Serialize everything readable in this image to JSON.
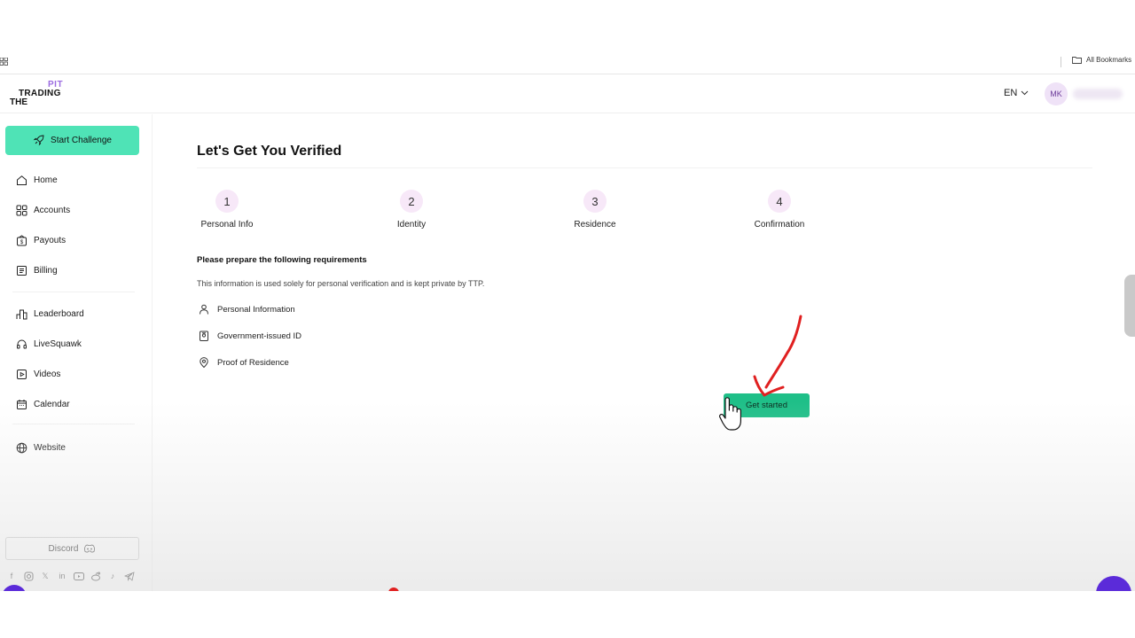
{
  "browser": {
    "bookmarks_label": "All Bookmarks"
  },
  "header": {
    "logo": {
      "the": "THE",
      "trading": "TRADING",
      "pit": "PIT"
    },
    "language": "EN",
    "avatar_initials": "MK"
  },
  "sidebar": {
    "start_challenge": "Start Challenge",
    "items": [
      {
        "label": "Home",
        "icon": "home-icon"
      },
      {
        "label": "Accounts",
        "icon": "grid-icon"
      },
      {
        "label": "Payouts",
        "icon": "wallet-icon"
      },
      {
        "label": "Billing",
        "icon": "document-icon"
      },
      {
        "label": "Leaderboard",
        "icon": "podium-icon"
      },
      {
        "label": "LiveSquawk",
        "icon": "headset-icon"
      },
      {
        "label": "Videos",
        "icon": "video-icon"
      },
      {
        "label": "Calendar",
        "icon": "calendar-icon"
      },
      {
        "label": "Website",
        "icon": "globe-icon"
      }
    ],
    "discord_label": "Discord",
    "socials": [
      "facebook-icon",
      "instagram-icon",
      "x-icon",
      "linkedin-icon",
      "youtube-icon",
      "reddit-icon",
      "tiktok-icon",
      "telegram-icon"
    ]
  },
  "main": {
    "title": "Let's Get You Verified",
    "steps": [
      {
        "number": "1",
        "label": "Personal Info"
      },
      {
        "number": "2",
        "label": "Identity"
      },
      {
        "number": "3",
        "label": "Residence"
      },
      {
        "number": "4",
        "label": "Confirmation"
      }
    ],
    "requirements_heading": "Please prepare the following requirements",
    "requirements_note": "This information is used solely for personal verification and is kept private by TTP.",
    "requirements": [
      {
        "label": "Personal Information",
        "icon": "person-icon"
      },
      {
        "label": "Government-issued ID",
        "icon": "id-card-icon"
      },
      {
        "label": "Proof of Residence",
        "icon": "location-pin-icon"
      }
    ],
    "get_started_label": "Get started"
  },
  "colors": {
    "start_challenge_bg": "#4fe3b6",
    "get_started_bg": "#1fbf88",
    "step_circle_bg": "#f7e8f8",
    "accent_purple": "#9b6be0",
    "annotation_red": "#e02020"
  }
}
